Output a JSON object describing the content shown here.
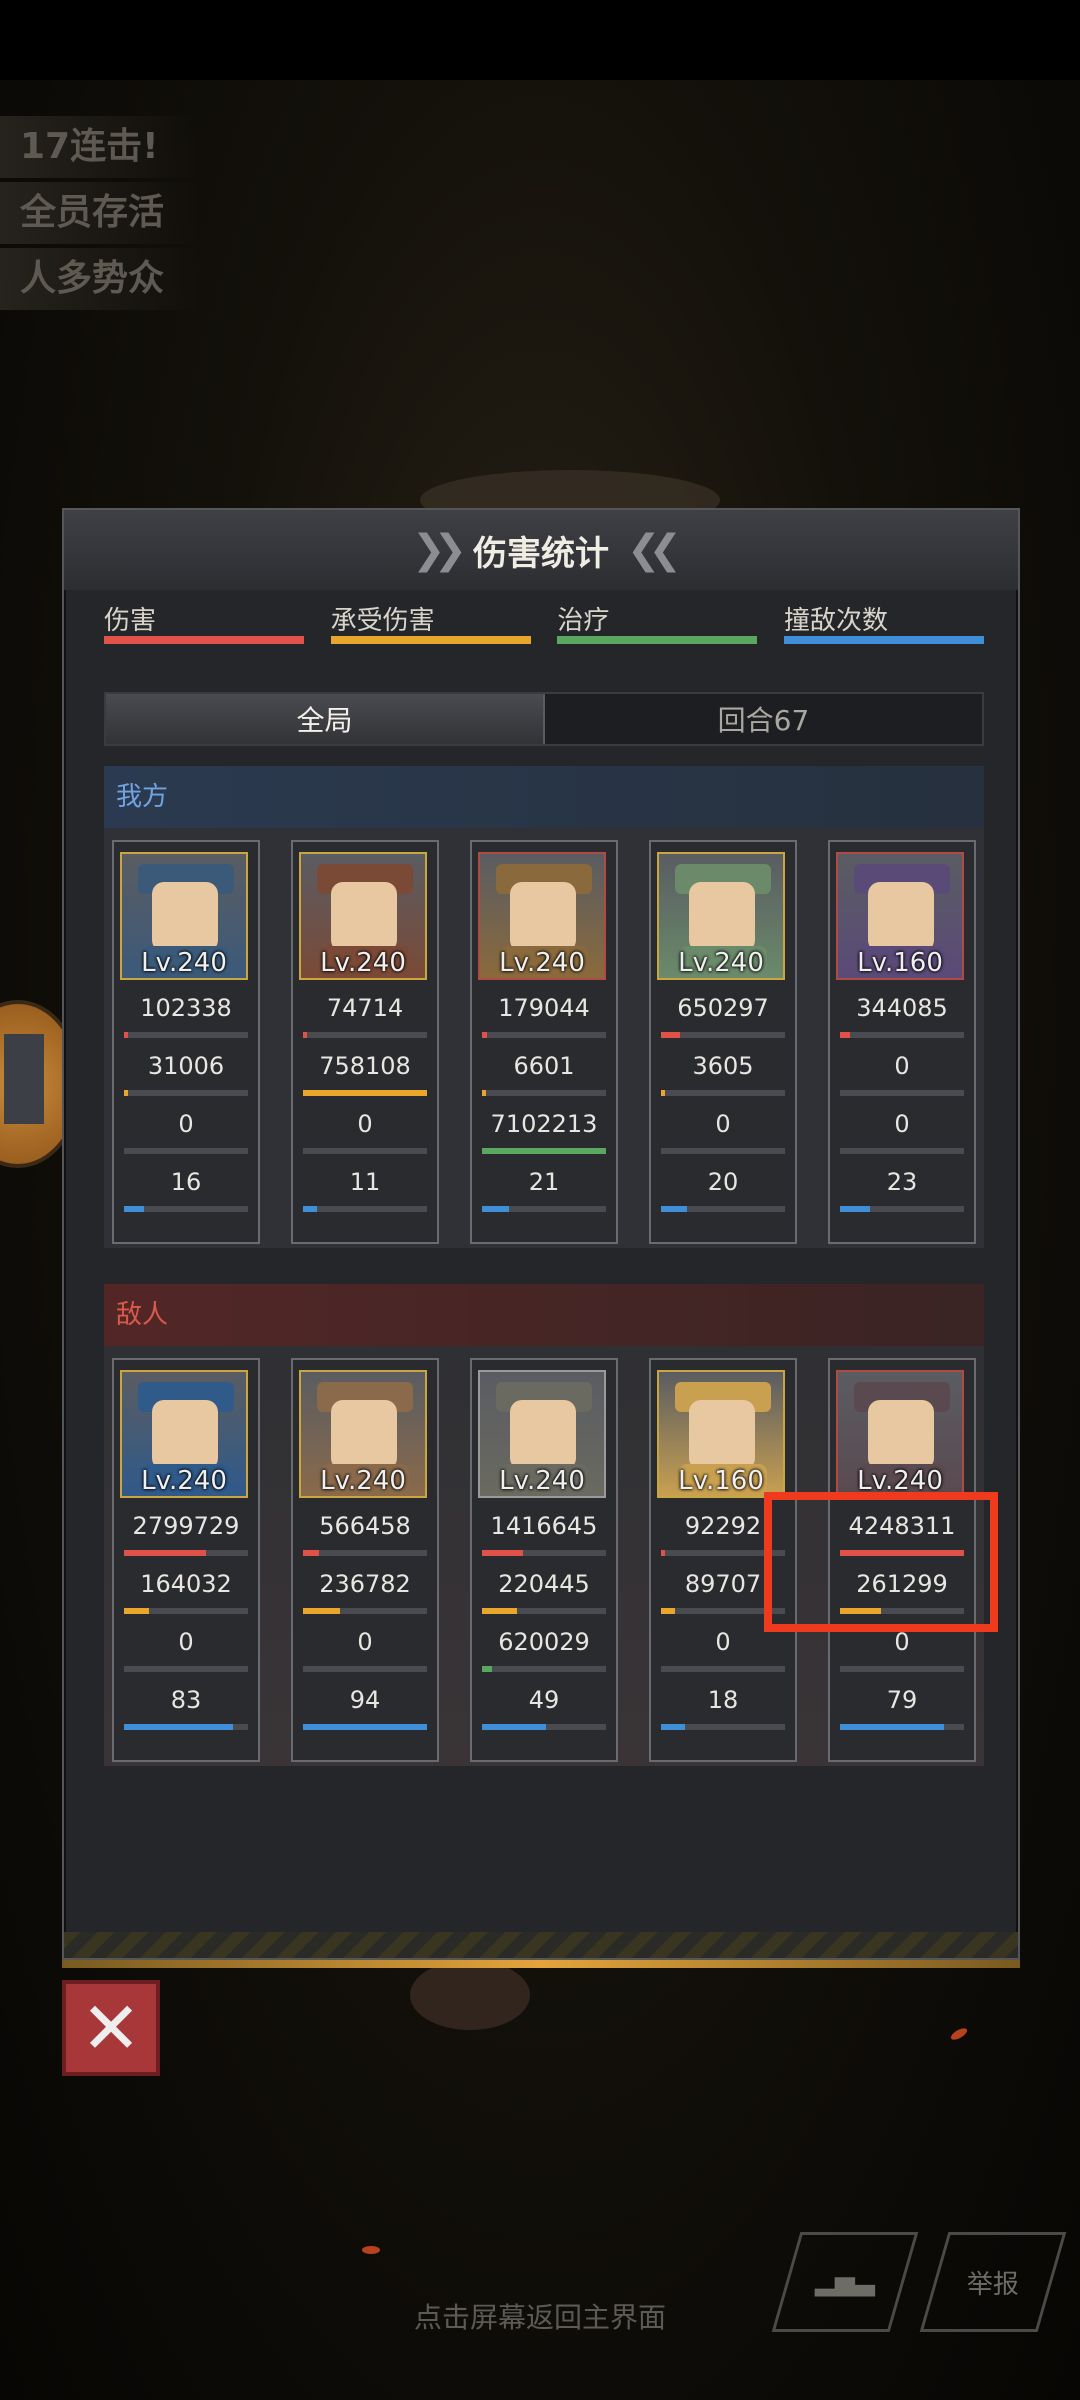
{
  "achievements": [
    "17连击!",
    "全员存活",
    "人多势众"
  ],
  "panel": {
    "title": "伤害统计",
    "legend": [
      {
        "label": "伤害",
        "color": "#e0514a"
      },
      {
        "label": "承受伤害",
        "color": "#e8a72c"
      },
      {
        "label": "治疗",
        "color": "#5aa860"
      },
      {
        "label": "撞敌次数",
        "color": "#3f8fd8"
      }
    ],
    "tabs": [
      {
        "label": "全局",
        "active": true
      },
      {
        "label": "回合67",
        "active": false
      }
    ],
    "allies": {
      "label": "我方",
      "units": [
        {
          "level": "Lv.240",
          "damage": "102338",
          "taken": "31006",
          "heal": "0",
          "hits": "16",
          "fill": [
            0.03,
            0.03,
            0.0,
            0.16
          ],
          "portrait": "#3b5a7a",
          "frame": "gold"
        },
        {
          "level": "Lv.240",
          "damage": "74714",
          "taken": "758108",
          "heal": "0",
          "hits": "11",
          "fill": [
            0.02,
            1.0,
            0.0,
            0.11
          ],
          "portrait": "#7a4a36",
          "frame": "gold"
        },
        {
          "level": "Lv.240",
          "damage": "179044",
          "taken": "6601",
          "heal": "7102213",
          "hits": "21",
          "fill": [
            0.04,
            0.01,
            1.0,
            0.22
          ],
          "portrait": "#8a6a3c",
          "frame": "red"
        },
        {
          "level": "Lv.240",
          "damage": "650297",
          "taken": "3605",
          "heal": "0",
          "hits": "20",
          "fill": [
            0.15,
            0.01,
            0.0,
            0.21
          ],
          "portrait": "#6a8a6a",
          "frame": "gold"
        },
        {
          "level": "Lv.160",
          "damage": "344085",
          "taken": "0",
          "heal": "0",
          "hits": "23",
          "fill": [
            0.08,
            0.0,
            0.0,
            0.24
          ],
          "portrait": "#5a4a78",
          "frame": "red"
        }
      ]
    },
    "enemies": {
      "label": "敌人",
      "units": [
        {
          "level": "Lv.240",
          "damage": "2799729",
          "taken": "164032",
          "heal": "0",
          "hits": "83",
          "fill": [
            0.66,
            0.2,
            0.0,
            0.88
          ],
          "portrait": "#2f5a8a",
          "frame": "gold"
        },
        {
          "level": "Lv.240",
          "damage": "566458",
          "taken": "236782",
          "heal": "0",
          "hits": "94",
          "fill": [
            0.13,
            0.3,
            0.0,
            1.0
          ],
          "portrait": "#8a6a4a",
          "frame": "gold"
        },
        {
          "level": "Lv.240",
          "damage": "1416645",
          "taken": "220445",
          "heal": "620029",
          "hits": "49",
          "fill": [
            0.33,
            0.28,
            0.08,
            0.52
          ],
          "portrait": "#6a6a60",
          "frame": "gray"
        },
        {
          "level": "Lv.160",
          "damage": "92292",
          "taken": "89707",
          "heal": "0",
          "hits": "18",
          "fill": [
            0.02,
            0.11,
            0.0,
            0.19
          ],
          "portrait": "#c8a050",
          "frame": "gold"
        },
        {
          "level": "Lv.240",
          "damage": "4248311",
          "taken": "261299",
          "heal": "0",
          "hits": "79",
          "fill": [
            1.0,
            0.33,
            0.0,
            0.84
          ],
          "portrait": "#5a4a50",
          "frame": "red"
        }
      ]
    }
  },
  "footer": {
    "hint": "点击屏幕返回主界面",
    "report_label": "举报",
    "close_icon": "close-icon",
    "stats_icon": "bar-chart-icon"
  }
}
